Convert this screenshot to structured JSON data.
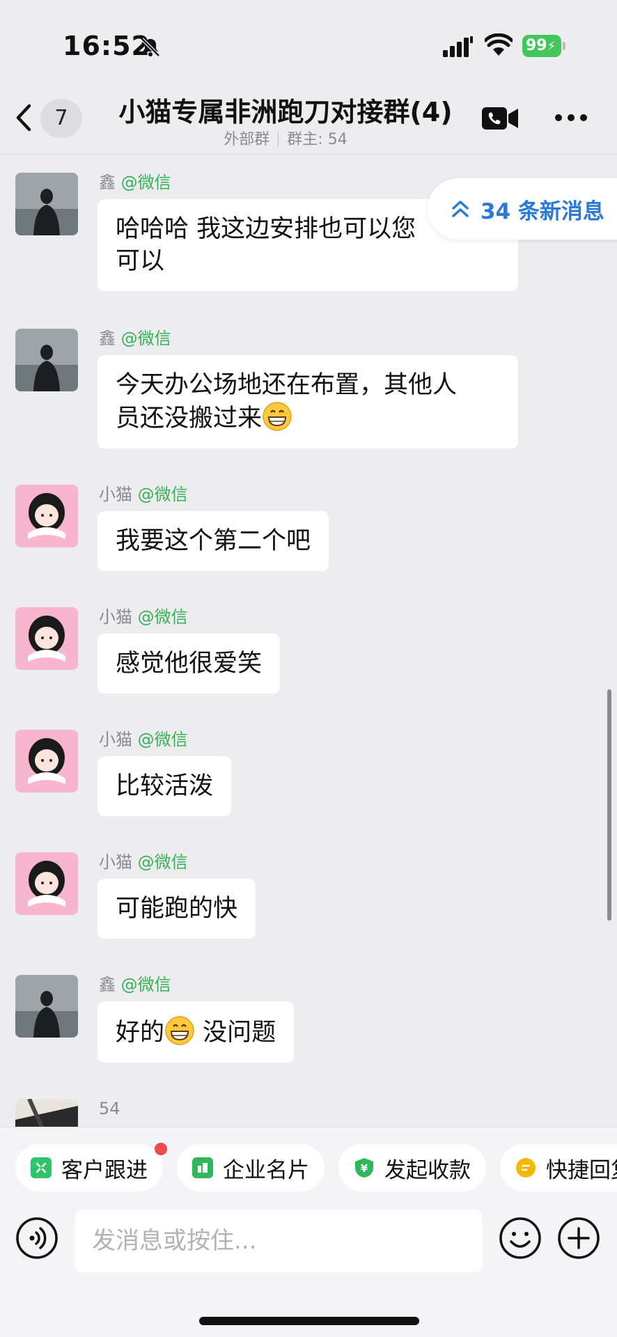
{
  "status_bar": {
    "time": "16:52",
    "battery": "99"
  },
  "header": {
    "unread_count": "7",
    "title": "小猫专属非洲跑刀对接群(4)",
    "subtitle_type": "外部群",
    "subtitle_owner": "群主: 54"
  },
  "new_messages": {
    "label": "34 条新消息"
  },
  "messages": [
    {
      "sender": "鑫",
      "source": "@微信",
      "text_line1": "哈哈哈 我这边安排也可以您",
      "text_line2": "可以"
    },
    {
      "sender": "鑫",
      "source": "@微信",
      "text_line1": "今天办公场地还在布置，其他人",
      "text_line2": "员还没搬过来"
    },
    {
      "sender": "小猫",
      "source": "@微信",
      "text": "我要这个第二个吧"
    },
    {
      "sender": "小猫",
      "source": "@微信",
      "text": "感觉他很爱笑"
    },
    {
      "sender": "小猫",
      "source": "@微信",
      "text": "比较活泼"
    },
    {
      "sender": "小猫",
      "source": "@微信",
      "text": "可能跑的快"
    },
    {
      "sender": "鑫",
      "source": "@微信",
      "text_before": "好的",
      "text_after": " 没问题"
    },
    {
      "sender": "54",
      "source": ""
    }
  ],
  "quick_actions": [
    {
      "label": "客户跟进",
      "color": "#2fc46a"
    },
    {
      "label": "企业名片",
      "color": "#2fb85a"
    },
    {
      "label": "发起收款",
      "color": "#2fb85a"
    },
    {
      "label": "快捷回复",
      "color": "#f5b800"
    }
  ],
  "input": {
    "placeholder": "发消息或按住..."
  },
  "colors": {
    "accent_blue": "#2a78d8",
    "source_green": "#34b254",
    "background": "#ededf0"
  }
}
